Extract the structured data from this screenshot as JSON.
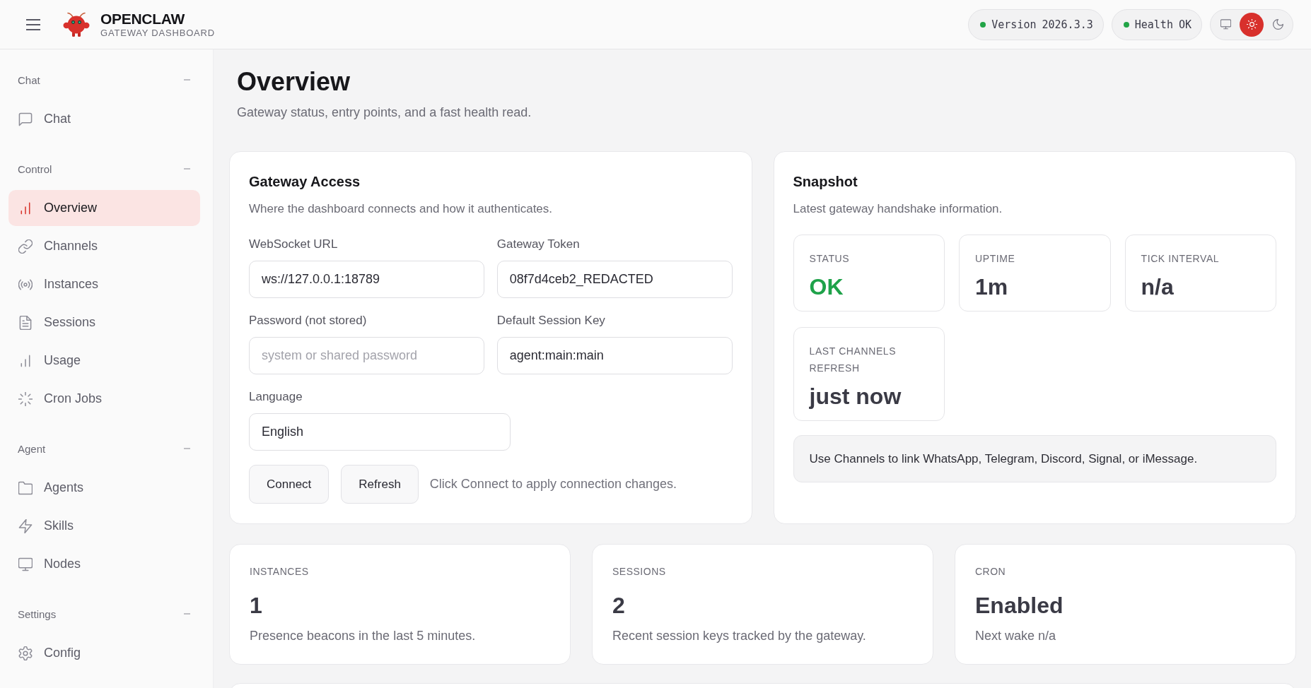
{
  "header": {
    "brand": {
      "title": "OPENCLAW",
      "subtitle": "GATEWAY DASHBOARD"
    },
    "status_pills": [
      {
        "label": "Version",
        "value": "2026.3.3",
        "color": "#22a447"
      },
      {
        "label": "Health",
        "value": "OK",
        "color": "#22a447"
      }
    ],
    "theme_options": [
      {
        "kind": "system",
        "selected": false
      },
      {
        "kind": "light",
        "selected": true
      },
      {
        "kind": "dark",
        "selected": false
      }
    ]
  },
  "sidebar": {
    "sections": [
      {
        "label": "Chat",
        "expanded": true,
        "items": [
          {
            "label": "Chat",
            "kind": "chat",
            "selected": false
          }
        ]
      },
      {
        "label": "Control",
        "expanded": true,
        "items": [
          {
            "label": "Overview",
            "kind": "chart",
            "selected": true
          },
          {
            "label": "Channels",
            "kind": "link",
            "selected": false
          },
          {
            "label": "Instances",
            "kind": "radio",
            "selected": false
          },
          {
            "label": "Sessions",
            "kind": "file",
            "selected": false
          },
          {
            "label": "Usage",
            "kind": "chart",
            "selected": false
          },
          {
            "label": "Cron Jobs",
            "kind": "loader",
            "selected": false
          }
        ]
      },
      {
        "label": "Agent",
        "expanded": true,
        "items": [
          {
            "label": "Agents",
            "kind": "folder",
            "selected": false
          },
          {
            "label": "Skills",
            "kind": "zap",
            "selected": false
          },
          {
            "label": "Nodes",
            "kind": "monitor",
            "selected": false
          }
        ]
      },
      {
        "label": "Settings",
        "expanded": true,
        "items": [
          {
            "label": "Config",
            "kind": "gear",
            "selected": false
          }
        ]
      }
    ]
  },
  "page": {
    "title": "Overview",
    "subtitle": "Gateway status, entry points, and a fast health read."
  },
  "gateway_access": {
    "title": "Gateway Access",
    "description": "Where the dashboard connects and how it authenticates.",
    "fields": [
      {
        "kind": "text",
        "label": "WebSocket URL",
        "value": "ws://127.0.0.1:18789"
      },
      {
        "kind": "text",
        "label": "Gateway Token",
        "value": "08f7d4ceb2_REDACTED"
      },
      {
        "kind": "password",
        "label": "Password (not stored)",
        "placeholder": "system or shared password"
      },
      {
        "kind": "text",
        "label": "Default Session Key",
        "value": "agent:main:main"
      },
      {
        "kind": "select",
        "label": "Language",
        "value": "English"
      }
    ],
    "buttons": [
      "Connect",
      "Refresh"
    ],
    "hint": "Click Connect to apply connection changes."
  },
  "snapshot": {
    "title": "Snapshot",
    "description": "Latest gateway handshake information.",
    "stats": [
      {
        "label": "STATUS",
        "value": "OK",
        "kind": "success"
      },
      {
        "label": "UPTIME",
        "value": "1m",
        "kind": "plain"
      },
      {
        "label": "TICK INTERVAL",
        "value": "n/a",
        "kind": "plain"
      },
      {
        "label": "LAST CHANNELS REFRESH",
        "value": "just now",
        "kind": "plain"
      }
    ],
    "note": "Use Channels to link WhatsApp, Telegram, Discord, Signal, or iMessage."
  },
  "summary_cards": [
    {
      "label": "INSTANCES",
      "value": "1",
      "description": "Presence beacons in the last 5 minutes."
    },
    {
      "label": "SESSIONS",
      "value": "2",
      "description": "Recent session keys tracked by the gateway."
    },
    {
      "label": "CRON",
      "value": "Enabled",
      "description": "Next wake n/a"
    }
  ]
}
